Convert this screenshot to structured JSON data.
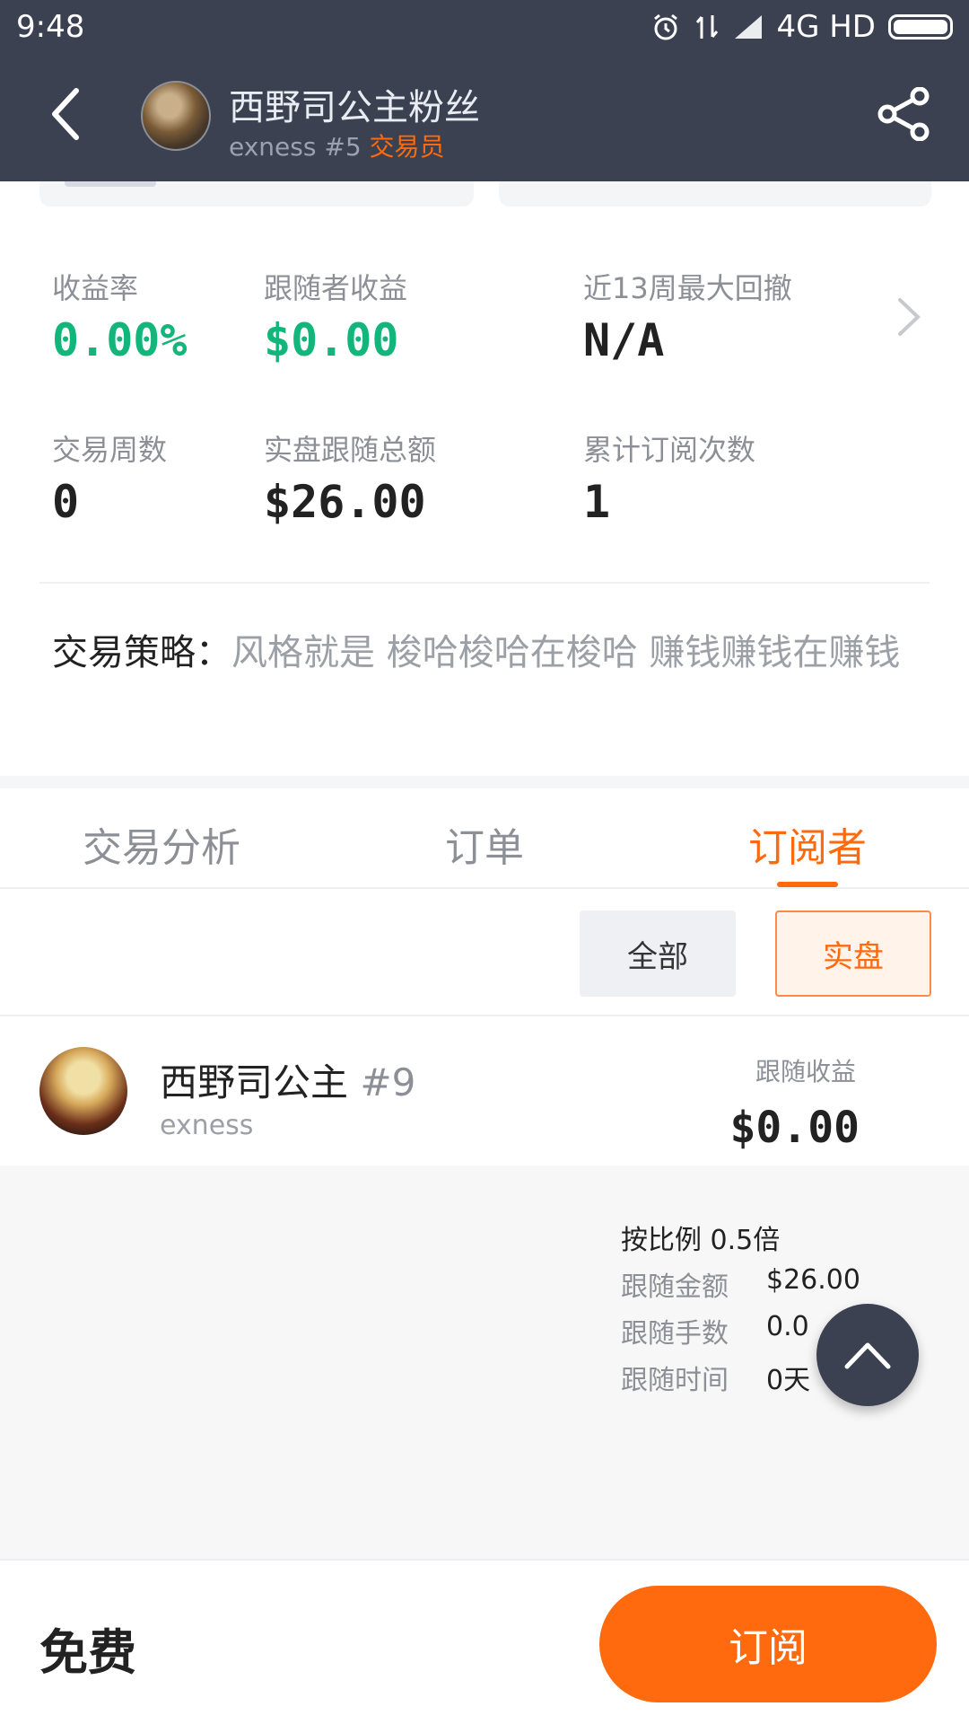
{
  "status_bar": {
    "time": "9:48",
    "network": "4G HD"
  },
  "header": {
    "title": "西野司公主粉丝",
    "broker": "exness #5",
    "role": "交易员",
    "back_icon": "back-arrow-icon",
    "share_icon": "share-icon"
  },
  "stats": [
    {
      "label": "收益率",
      "value": "0.00%",
      "color": "#13b67a"
    },
    {
      "label": "跟随者收益",
      "value": "$0.00",
      "color": "#13b67a"
    },
    {
      "label": "近13周最大回撤",
      "value": "N/A",
      "color": "#222222"
    },
    {
      "label": "交易周数",
      "value": "0",
      "color": "#222222"
    },
    {
      "label": "实盘跟随总额",
      "value": "$26.00",
      "color": "#222222"
    },
    {
      "label": "累计订阅次数",
      "value": "1",
      "color": "#222222"
    }
  ],
  "strategy": {
    "label": "交易策略：",
    "text": "风格就是  梭哈梭哈在梭哈  赚钱赚钱在赚钱"
  },
  "tabs": [
    {
      "label": "交易分析",
      "active": false
    },
    {
      "label": "订单",
      "active": false
    },
    {
      "label": "订阅者",
      "active": true
    }
  ],
  "filters": {
    "all_label": "全部",
    "live_label": "实盘"
  },
  "subscriber": {
    "name": "西野司公主",
    "number": "#9",
    "broker": "exness",
    "profit_label": "跟随收益",
    "profit_value": "$0.00",
    "ratio": "按比例 0.5倍",
    "details": [
      {
        "label": "跟随金额",
        "value": "$26.00"
      },
      {
        "label": "跟随手数",
        "value": "0.0"
      },
      {
        "label": "跟随时间",
        "value": "0天"
      }
    ]
  },
  "bottom": {
    "price": "免费",
    "subscribe_label": "订阅"
  },
  "colors": {
    "header_bg": "#3b4150",
    "accent": "#ff6a0f",
    "profit_green": "#13b67a"
  }
}
